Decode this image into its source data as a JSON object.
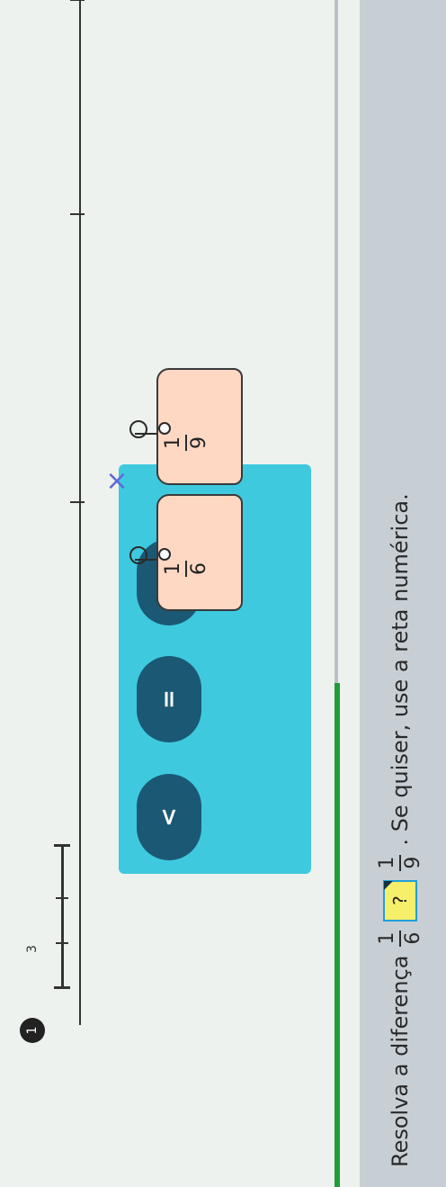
{
  "step_badge": "1",
  "mini_ruler_label": "3",
  "close_label": "×",
  "choices": [
    {
      "symbol": "<"
    },
    {
      "symbol": "="
    },
    {
      "symbol": ">"
    }
  ],
  "tags": [
    {
      "numerator": "1",
      "denominator": "6"
    },
    {
      "numerator": "1",
      "denominator": "9"
    }
  ],
  "instruction": {
    "prefix": "Resolva a diferença",
    "left_numerator": "1",
    "left_denominator": "6",
    "answer_placeholder": "?",
    "right_numerator": "1",
    "right_denominator": "9",
    "suffix": ". Se quiser, use a reta numérica."
  }
}
